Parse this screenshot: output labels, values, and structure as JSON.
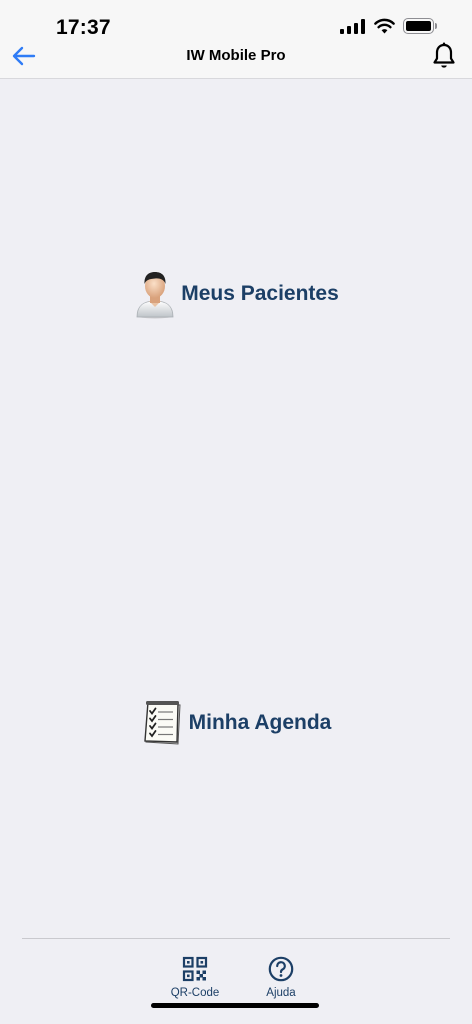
{
  "status_bar": {
    "time": "17:37",
    "signal_icon": "cellular-signal-icon",
    "wifi_icon": "wifi-icon",
    "battery_icon": "battery-icon",
    "battery_level": 1.0
  },
  "nav": {
    "title": "IW Mobile Pro",
    "back_icon": "arrow-left-icon",
    "notifications_icon": "bell-icon",
    "accent": "#2f7cf6"
  },
  "menu": {
    "items": [
      {
        "label": "Meus Pacientes",
        "icon": "user-avatar-icon"
      },
      {
        "label": "Minha Agenda",
        "icon": "checklist-icon"
      }
    ],
    "label_color": "#1c3f66"
  },
  "tabbar": {
    "items": [
      {
        "label": "QR-Code",
        "icon": "qr-code-icon"
      },
      {
        "label": "Ajuda",
        "icon": "help-circle-icon"
      }
    ]
  }
}
